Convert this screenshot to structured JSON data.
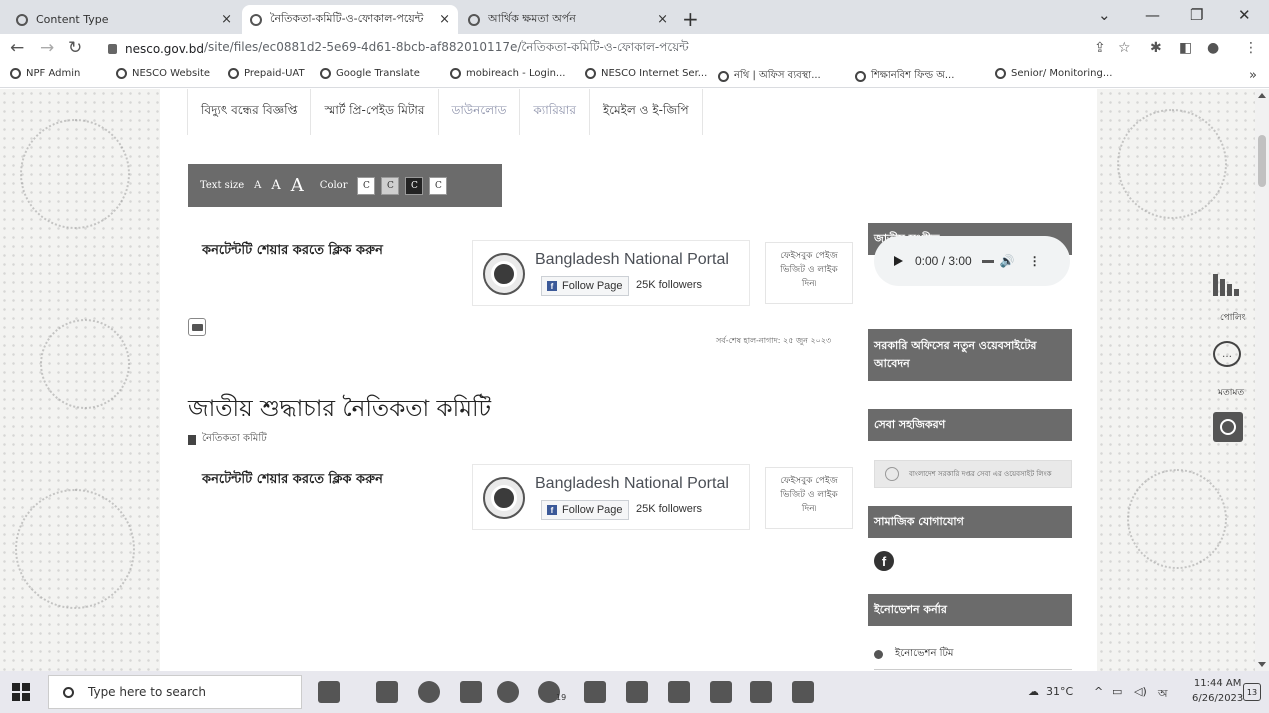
{
  "browser": {
    "tabs": [
      {
        "label": "Content Type",
        "active": false
      },
      {
        "label": "নৈতিকতা-কমিটি-ও-ফোকাল-পয়েন্ট",
        "active": true
      },
      {
        "label": "আর্থিক ক্ষমতা অর্পন",
        "active": false
      }
    ],
    "url_host": "nesco.gov.bd",
    "url_path": "/site/files/ec0881d2-5e69-4d61-8bcb-af882010117e/নৈতিকতা-কমিটি-ও-ফোকাল-পয়েন্ট",
    "bookmarks": [
      "NPF Admin",
      "NESCO Website",
      "Prepaid-UAT",
      "Google Translate",
      "mobireach - Login...",
      "NESCO Internet Ser...",
      "নথি | অফিস ব্যবস্থা...",
      "শিক্ষানবিশ ফিল্ড অ...",
      "Senior/ Monitoring..."
    ]
  },
  "page": {
    "menu_tabs": [
      "বিদ্যুৎ বন্ধের বিজ্ঞপ্তি",
      "স্মার্ট প্রি-পেইড মিটার",
      "ডাউনলোড",
      "ক্যারিয়ার",
      "ইমেইল ও ই-জিপি"
    ],
    "accessibility": {
      "text_size_label": "Text size",
      "sizes": [
        "A",
        "A",
        "A"
      ],
      "color_label": "Color",
      "color_swatches": [
        "C",
        "C",
        "C",
        "C"
      ]
    },
    "share_text": "কনটেন্টটি শেয়ার করতে ক্লিক করুন",
    "fb_widget": {
      "title": "Bangladesh National Portal",
      "follow_label": "Follow Page",
      "followers": "25K followers",
      "note": "ফেইসবুক পেইজ ভিজিট ও লাইক দিন৷"
    },
    "last_updated": "সর্ব-শেষ হাল-নাগাদ: ২৫ জুন ২০২৩",
    "section_title": "জাতীয় শুদ্ধাচার নৈতিকতা কমিটি",
    "subpage_link": "নৈতিকতা কমিটি",
    "sidebar": {
      "anthem_head": "জাতীয় সংগীত",
      "audio_time": "0:00 / 3:00",
      "new_website_head": "সরকারি অফিসের নতুন ওয়েবসাইটের আবেদন",
      "service_head": "সেবা সহজিকরণ",
      "service_banner": "বাংলাদেশ সরকারি দপ্তর সেবা এর ওয়েবসাইট লিংক",
      "social_head": "সামাজিক যোগাযোগ",
      "innovation_head": "ইনোভেশন কর্নার",
      "innovation_item": "ইনোভেশন টিম"
    },
    "widgets": {
      "poll_label": "পোলিং",
      "feedback_label": "মতামত"
    }
  },
  "taskbar": {
    "search_placeholder": "Type here to search",
    "badge": "19",
    "weather": "31°C",
    "time": "11:44 AM",
    "date": "6/26/2023",
    "notif_count": "13"
  }
}
